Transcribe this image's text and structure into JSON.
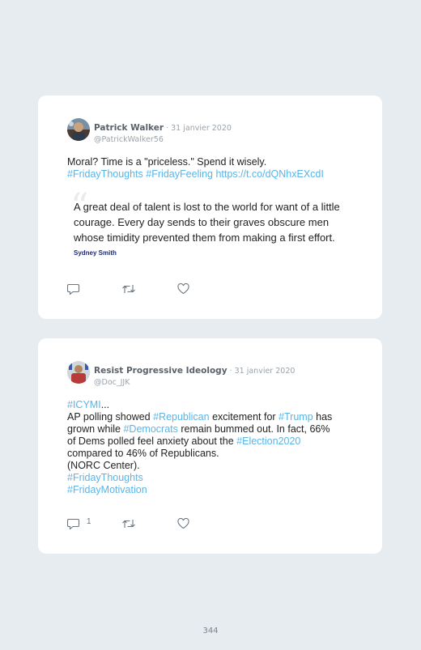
{
  "tweets": [
    {
      "author": "Patrick Walker",
      "dot": " · ",
      "date": "31 janvier 2020",
      "handle": "@PatrickWalker56",
      "text_plain": "Moral? Time is a \"priceless.\" Spend it wisely.",
      "tag1": "#FridayThoughts",
      "tag2": "#FridayFeeling",
      "link": "https://t.co/dQNhxEXcdI",
      "quote_mark": "“",
      "quote": "A great deal of talent is lost to the world for want of a little courage. Every day sends to their graves obscure men whose timidity prevented them from making a first effort.",
      "quote_author": "Sydney Smith",
      "icons": [
        "reply-icon",
        "retweet-icon",
        "like-icon"
      ]
    },
    {
      "author": "Resist Progressive Ideology",
      "dot": " · ",
      "date": "31 janvier 2020",
      "handle": "@Doc_JJK",
      "icymi": "#ICYMI",
      "ellipsis": "...",
      "l1a": "AP polling showed ",
      "l1tag1": "#Republican",
      "l1b": " excitement for ",
      "l1tag2": "#Trump",
      "l1c": " has",
      "l2a": "grown while ",
      "l2tag": "#Democrats",
      "l2b": " remain bummed out. In fact, 66%",
      "l3a": "of Dems polled feel anxiety about the ",
      "l3tag": "#Election2020",
      "l4": "compared to 46% of Republicans.",
      "l5": "(NORC Center).",
      "tag_a": "#FridayThoughts",
      "tag_b": "#FridayMotivation",
      "reply_count": "1",
      "icons": [
        "reply-icon",
        "retweet-icon",
        "like-icon"
      ]
    }
  ],
  "page_number": "344"
}
